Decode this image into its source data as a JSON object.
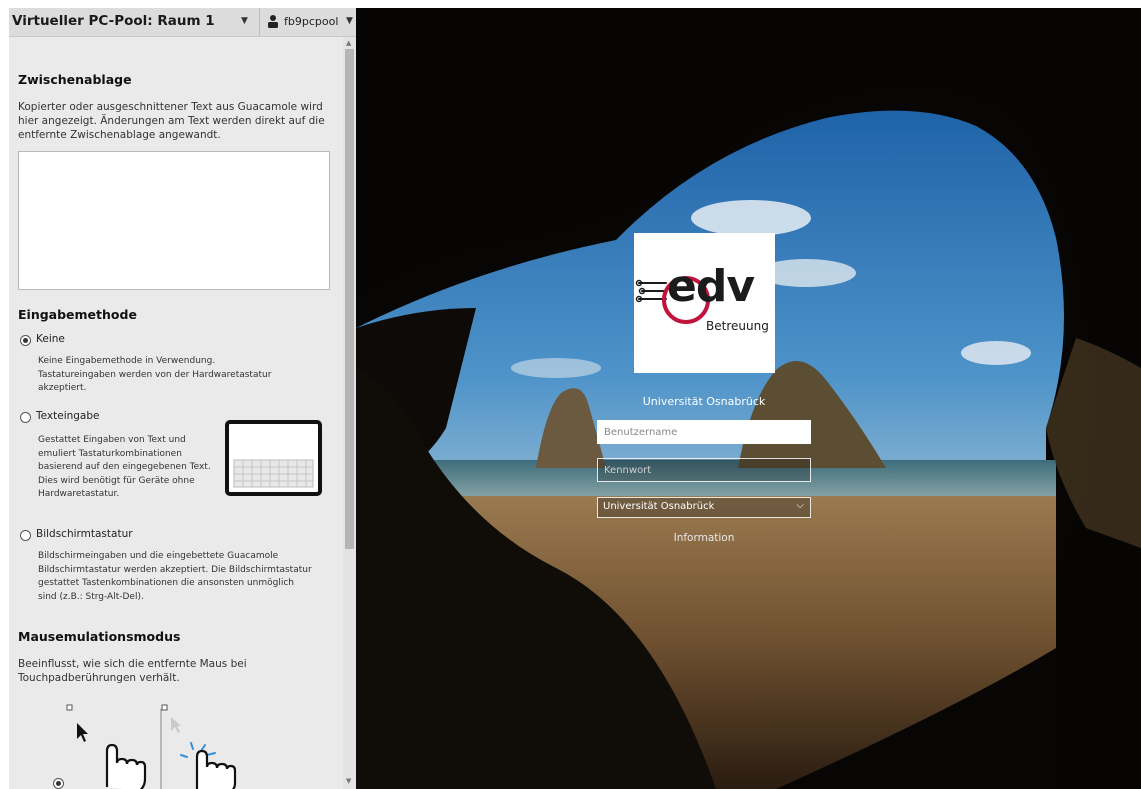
{
  "header": {
    "connection_name": "Virtueller PC-Pool: Raum 1",
    "username": "fb9pcpool"
  },
  "clipboard": {
    "title": "Zwischenablage",
    "description": "Kopierter oder ausgeschnittener Text aus Guacamole wird hier angezeigt. Änderungen am Text werden direkt auf die entfernte Zwischenablage angewandt.",
    "value": ""
  },
  "input_method": {
    "title": "Eingabemethode",
    "options": [
      {
        "label": "Keine",
        "selected": true,
        "description": "Keine Eingabemethode in Verwendung. Tastatureingaben werden von der Hardwaretastatur akzeptiert."
      },
      {
        "label": "Texteingabe",
        "selected": false,
        "description": "Gestattet Eingaben von Text und emuliert Tastaturkombinationen basierend auf den eingegebenen Text. Dies wird benötigt für Geräte ohne Hardwaretastatur."
      },
      {
        "label": "Bildschirmtastatur",
        "selected": false,
        "description": "Bildschirmeingaben und die eingebettete Guacamole Bildschirmtastatur werden akzeptiert. Die Bildschirmtastatur gestattet Tastenkombinationen die ansonsten unmöglich sind (z.B.: Strg-Alt-Del)."
      }
    ]
  },
  "mouse_mode": {
    "title": "Mausemulationsmodus",
    "description": "Beeinflusst, wie sich die entfernte Maus bei Touchpadberührungen verhält.",
    "selected_index": 0
  },
  "login": {
    "logo_text": "edv",
    "logo_subtext": "Betreuung",
    "university": "Universität Osnabrück",
    "username_placeholder": "Benutzername",
    "password_placeholder": "Kennwort",
    "domain_value": "Universität Osnabrück",
    "info_link": "Information"
  },
  "colors": {
    "menu_bg": "#eaeaea",
    "header_bg": "#dcdcdc",
    "logo_red": "#c0143c",
    "logo_dark": "#1b1b1b"
  }
}
